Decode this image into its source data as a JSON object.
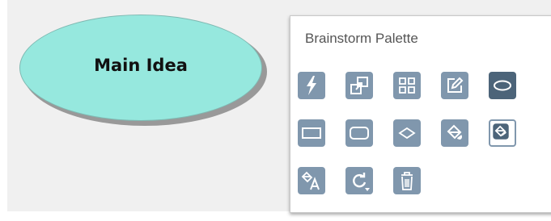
{
  "node": {
    "label": "Main Idea"
  },
  "palette": {
    "title": "Brainstorm Palette",
    "tools": [
      {
        "name": "quick-add-icon",
        "state": "normal"
      },
      {
        "name": "expand-node-icon",
        "state": "normal"
      },
      {
        "name": "grid-layout-icon",
        "state": "normal"
      },
      {
        "name": "edit-note-icon",
        "state": "normal"
      },
      {
        "name": "oval-shape-icon",
        "state": "selected"
      },
      {
        "name": "rectangle-shape-icon",
        "state": "normal"
      },
      {
        "name": "rounded-rectangle-shape-icon",
        "state": "normal"
      },
      {
        "name": "diamond-shape-icon",
        "state": "normal"
      },
      {
        "name": "fill-color-icon",
        "state": "normal"
      },
      {
        "name": "line-color-icon",
        "state": "highlighted"
      },
      {
        "name": "text-color-icon",
        "state": "normal"
      },
      {
        "name": "rotate-icon",
        "state": "normal"
      },
      {
        "name": "delete-icon",
        "state": "normal"
      }
    ]
  },
  "colors": {
    "node_fill": "#96e8de",
    "tool_button": "#8097ad",
    "tool_button_selected": "#4c6479",
    "canvas": "#f0f0f0"
  }
}
